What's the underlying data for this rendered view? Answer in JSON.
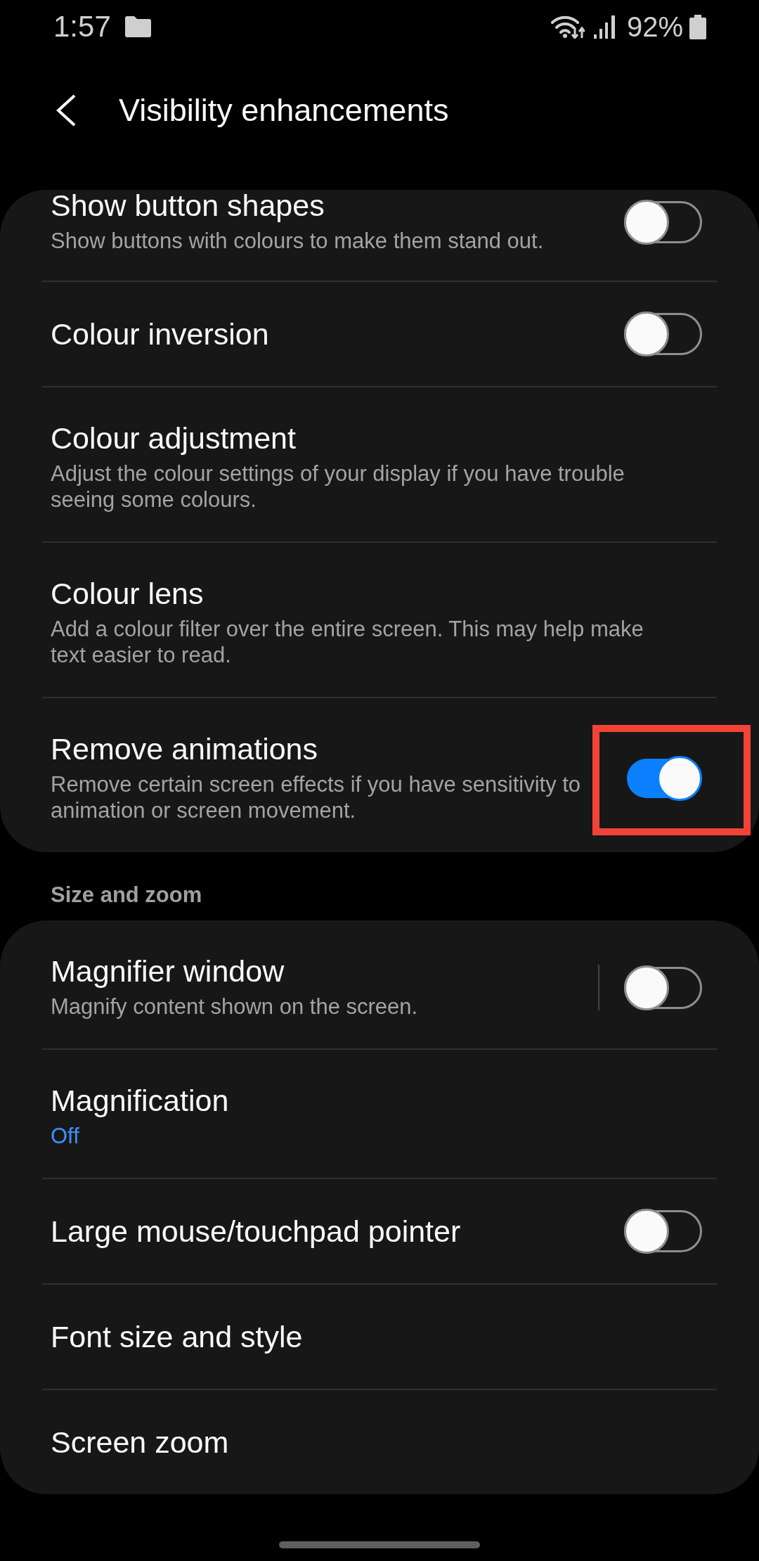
{
  "status_bar": {
    "time": "1:57",
    "battery": "92%"
  },
  "header": {
    "title": "Visibility enhancements"
  },
  "sections": [
    {
      "items": [
        {
          "kind": "toggle",
          "title": "Show button shapes",
          "subtitle": "Show buttons with colours to make them stand out.",
          "on": false,
          "highlighted": false
        },
        {
          "kind": "toggle",
          "title": "Colour inversion",
          "on": false,
          "highlighted": false
        },
        {
          "kind": "link",
          "title": "Colour adjustment",
          "subtitle": "Adjust the colour settings of your display if you have trouble seeing some colours.",
          "highlighted": false
        },
        {
          "kind": "link",
          "title": "Colour lens",
          "subtitle": "Add a colour filter over the entire screen. This may help make text easier to read.",
          "highlighted": false
        },
        {
          "kind": "toggle",
          "title": "Remove animations",
          "subtitle": "Remove certain screen effects if you have sensitivity to animation or screen movement.",
          "on": true,
          "highlighted": true
        }
      ]
    },
    {
      "title": "Size and zoom",
      "items": [
        {
          "kind": "split",
          "title": "Magnifier window",
          "subtitle": "Magnify content shown on the screen.",
          "on": false,
          "highlighted": false
        },
        {
          "kind": "link",
          "title": "Magnification",
          "summary": "Off",
          "highlighted": false
        },
        {
          "kind": "toggle",
          "title": "Large mouse/touchpad pointer",
          "on": false,
          "highlighted": false
        },
        {
          "kind": "link",
          "title": "Font size and style",
          "highlighted": false
        },
        {
          "kind": "link",
          "title": "Screen zoom",
          "highlighted": false
        }
      ]
    }
  ]
}
